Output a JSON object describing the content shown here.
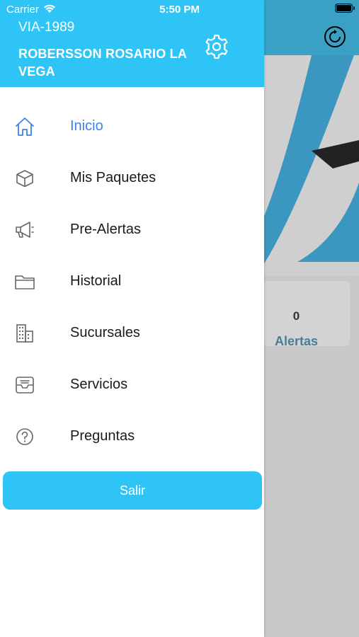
{
  "status_bar": {
    "carrier": "Carrier",
    "time": "5:50 PM"
  },
  "drawer": {
    "user_code": "VIA-1989",
    "user_name": "ROBERSSON ROSARIO LA VEGA",
    "menu": [
      {
        "label": "Inicio",
        "icon": "home-icon",
        "active": true
      },
      {
        "label": "Mis Paquetes",
        "icon": "package-icon",
        "active": false
      },
      {
        "label": "Pre-Alertas",
        "icon": "megaphone-icon",
        "active": false
      },
      {
        "label": "Historial",
        "icon": "folder-icon",
        "active": false
      },
      {
        "label": "Sucursales",
        "icon": "building-icon",
        "active": false
      },
      {
        "label": "Servicios",
        "icon": "inbox-icon",
        "active": false
      },
      {
        "label": "Preguntas",
        "icon": "question-icon",
        "active": false
      }
    ],
    "logout_label": "Salir"
  },
  "background": {
    "card_count": "0",
    "card_label": "Alertas"
  },
  "colors": {
    "drawer_header": "#2ec5f6",
    "active_item": "#3a82f2",
    "app_header": "#3aa0c4"
  }
}
